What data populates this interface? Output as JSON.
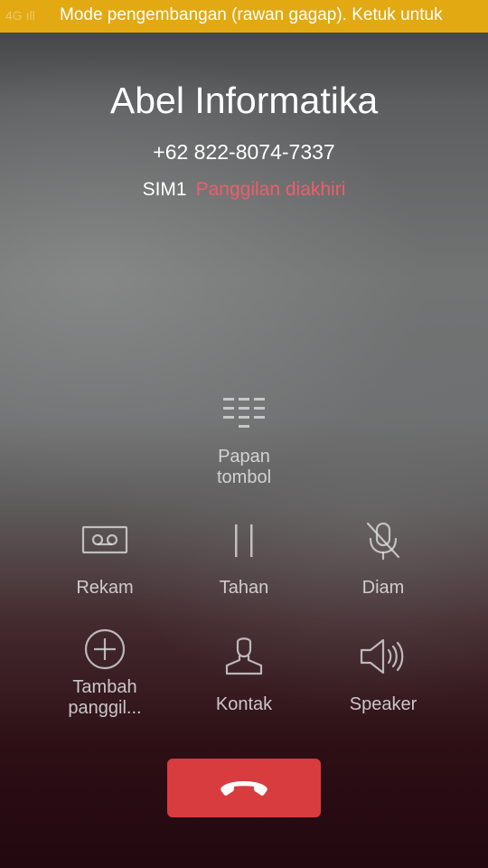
{
  "status_bar": {
    "ghost_text": "4G ıll",
    "notification_text": "Mode pengembangan (rawan gagap). Ketuk untuk",
    "background_color": "#e2a913"
  },
  "call": {
    "caller_name": "Abel Informatika",
    "phone_number": "+62 822-8074-7337",
    "sim": "SIM1",
    "state": "Panggilan diakhiri",
    "state_color": "#ef5d6b"
  },
  "actions": {
    "keypad": {
      "label_line1": "Papan",
      "label_line2": "tombol",
      "icon": "dialpad-icon"
    },
    "record": {
      "label": "Rekam",
      "icon": "record-icon"
    },
    "hold": {
      "label": "Tahan",
      "icon": "pause-icon"
    },
    "mute": {
      "label": "Diam",
      "icon": "mic-off-icon"
    },
    "add_call": {
      "label_line1": "Tambah",
      "label_line2": "panggil...",
      "icon": "add-circle-icon"
    },
    "contacts": {
      "label": "Kontak",
      "icon": "person-icon"
    },
    "speaker": {
      "label": "Speaker",
      "icon": "speaker-icon"
    }
  },
  "end_call": {
    "icon": "hang-up-icon",
    "color": "#d83c3f"
  }
}
